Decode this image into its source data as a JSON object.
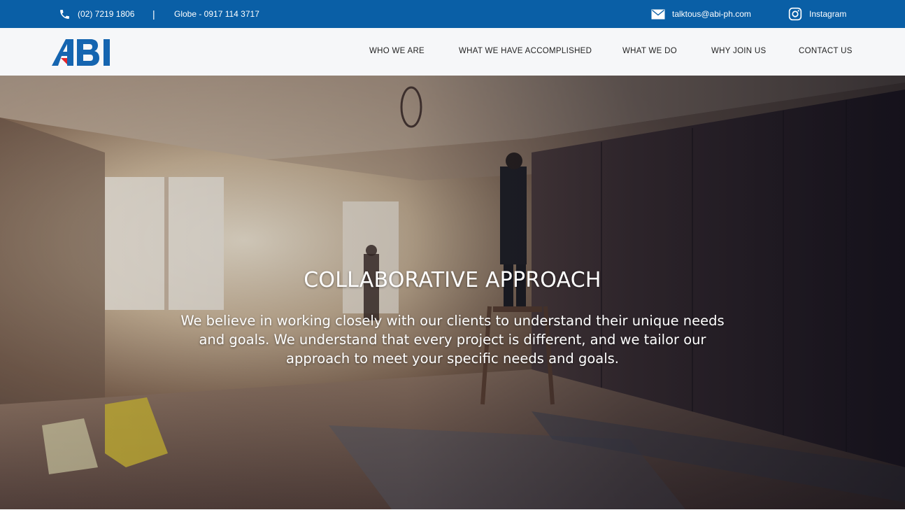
{
  "topbar": {
    "phone": "(02) 7219 1806",
    "separator": "|",
    "globe": "Globe - 0917 114 3717",
    "email": "talktous@abi-ph.com",
    "instagram": "Instagram",
    "icons": [
      "phone-icon",
      "mail-icon",
      "instagram-icon"
    ],
    "background": "#0a5fa6"
  },
  "logo": {
    "text": "ABI",
    "color": "#1565b0",
    "accent": "#e3262d"
  },
  "nav": {
    "items": [
      "WHO WE ARE",
      "WHAT WE HAVE ACCOMPLISHED",
      "WHAT WE DO",
      "WHY JOIN US",
      "CONTACT US"
    ]
  },
  "hero": {
    "title": "COLLABORATIVE APPROACH",
    "text": "We believe in working closely with our clients to understand their unique needs and goals. We understand that every project is different, and we tailor our approach to meet your specific needs and goals."
  }
}
